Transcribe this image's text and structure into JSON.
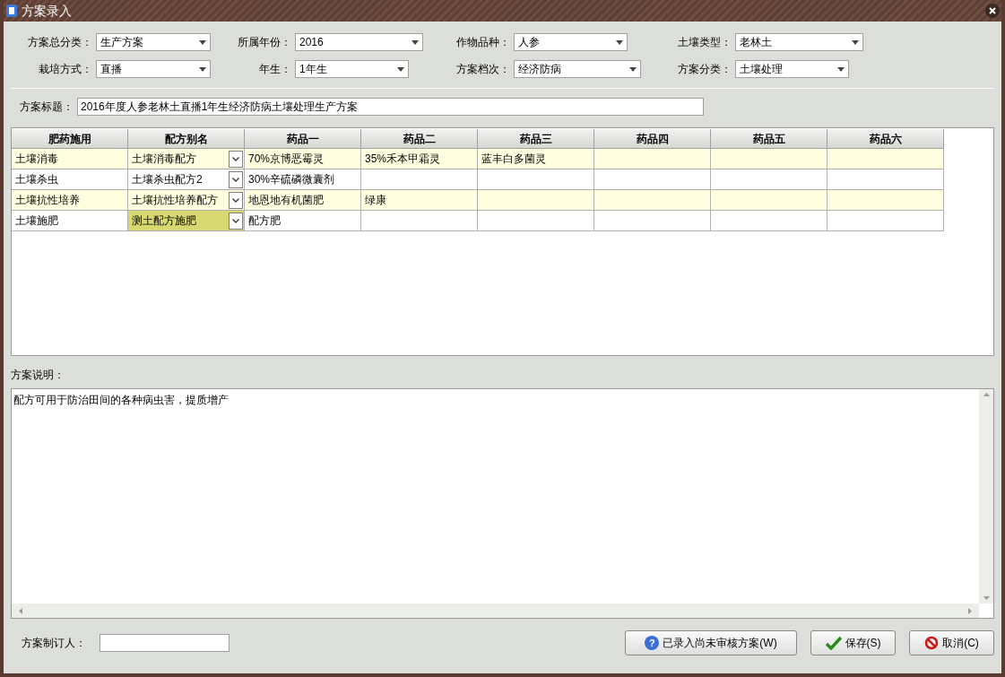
{
  "window": {
    "title": "方案录入"
  },
  "filters": [
    [
      {
        "label": "方案总分类：",
        "value": "生产方案"
      },
      {
        "label": "所属年份：",
        "value": "2016"
      },
      {
        "label": "作物品种：",
        "value": "人参"
      },
      {
        "label": "土壤类型：",
        "value": "老林土"
      }
    ],
    [
      {
        "label": "栽培方式：",
        "value": "直播"
      },
      {
        "label": "年生：",
        "value": "1年生"
      },
      {
        "label": "方案档次：",
        "value": "经济防病"
      },
      {
        "label": "方案分类：",
        "value": "土壤处理"
      }
    ]
  ],
  "plan_title": {
    "label": "方案标题：",
    "value": "2016年度人参老林土直播1年生经济防病土壤处理生产方案"
  },
  "table": {
    "columns": [
      "肥药施用",
      "配方别名",
      "药品一",
      "药品二",
      "药品三",
      "药品四",
      "药品五",
      "药品六"
    ],
    "rows": [
      {
        "cells": [
          "土壤消毒",
          "土壤消毒配方",
          "70%京博恶霉灵",
          "35%禾本甲霜灵",
          "蓝丰白多菌灵",
          "",
          "",
          ""
        ],
        "selected": false
      },
      {
        "cells": [
          "土壤杀虫",
          "土壤杀虫配方2",
          "30%辛硫磷微囊剂",
          "",
          "",
          "",
          "",
          ""
        ],
        "selected": false
      },
      {
        "cells": [
          "土壤抗性培养",
          "土壤抗性培养配方",
          "地恩地有机菌肥",
          "绿康",
          "",
          "",
          "",
          ""
        ],
        "selected": false
      },
      {
        "cells": [
          "土壤施肥",
          "测土配方施肥",
          "配方肥",
          "",
          "",
          "",
          "",
          ""
        ],
        "selected": true
      }
    ]
  },
  "description": {
    "label": "方案说明：",
    "value": "配方可用于防治田间的各种病虫害，提质增产"
  },
  "author": {
    "label": "方案制订人："
  },
  "buttons": [
    {
      "kind": "help",
      "icon_text": "?",
      "label": "已录入尚未审核方案(W)"
    },
    {
      "kind": "save",
      "label": "保存(S)"
    },
    {
      "kind": "cancel",
      "label": "取消(C)"
    }
  ]
}
